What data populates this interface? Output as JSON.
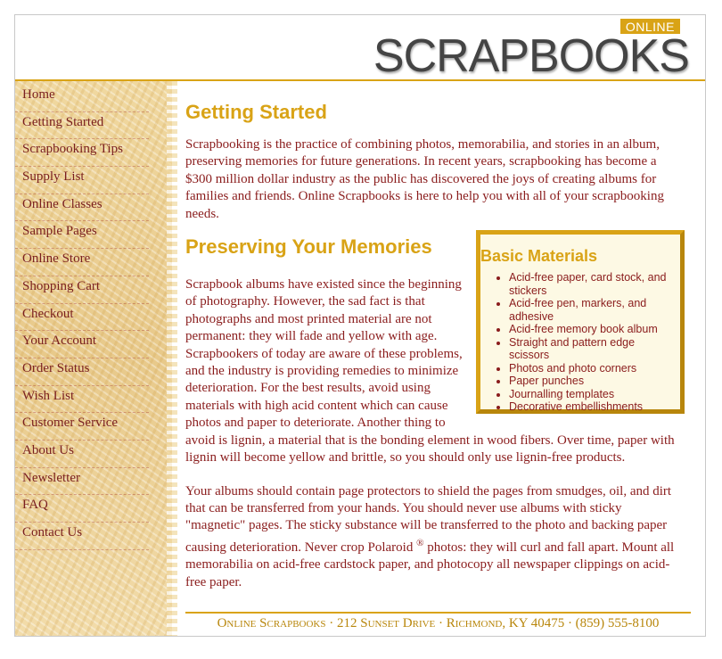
{
  "header": {
    "logo_online": "ONLINE",
    "logo_text": "SCRAPBOOKS"
  },
  "sidebar": {
    "items": [
      {
        "label": "Home"
      },
      {
        "label": "Getting Started"
      },
      {
        "label": "Scrapbooking Tips"
      },
      {
        "label": "Supply List"
      },
      {
        "label": "Online Classes"
      },
      {
        "label": "Sample Pages"
      },
      {
        "label": "Online Store"
      },
      {
        "label": "Shopping Cart"
      },
      {
        "label": "Checkout"
      },
      {
        "label": "Your Account"
      },
      {
        "label": "Order Status"
      },
      {
        "label": "Wish List"
      },
      {
        "label": "Customer Service"
      },
      {
        "label": "About Us"
      },
      {
        "label": "Newsletter"
      },
      {
        "label": "FAQ"
      },
      {
        "label": "Contact Us"
      }
    ]
  },
  "main": {
    "title": "Getting Started",
    "intro": "Scrapbooking is the practice of combining photos, memorabilia, and stories in an album, preserving memories for future generations. In recent years, scrapbooking has become a $300 million dollar industry as the public has discovered the joys of creating albums for families and friends. Online Scrapbooks is here to help you with all of your scrapbooking needs.",
    "section_title": "Preserving Your Memories",
    "para2": "Scrapbook albums have existed since the beginning of photography. However, the sad fact is that photographs and most printed material are not permanent: they will fade and yellow with age. Scrapbookers of today are aware of these problems, and the industry is providing remedies to minimize deterioration. For the best results, avoid using materials with high acid content which can cause photos and paper to deteriorate. Another thing to avoid is lignin, a material that is the bonding element in wood fibers. Over time, paper with lignin will become yellow and brittle, so you should only use lignin-free products.",
    "para3_before": "Your albums should contain page protectors to shield the pages from smudges, oil, and dirt that can be transferred from your hands. You should never use albums with sticky \"magnetic\" pages. The sticky substance will be transferred to the photo and backing paper causing deterioration. Never crop Polaroid ",
    "para3_sup": "®",
    "para3_after": " photos: they will curl and fall apart. Mount all memorabilia on acid-free cardstock paper, and photocopy all newspaper clippings on acid-free paper."
  },
  "box": {
    "title": "Basic Materials",
    "items": [
      "Acid-free paper, card stock, and stickers",
      "Acid-free pen, markers, and adhesive",
      "Acid-free memory book album",
      "Straight and pattern edge scissors",
      "Photos and photo corners",
      "Paper punches",
      "Journalling templates",
      "Decorative embellishments"
    ]
  },
  "footer": {
    "text": "Online Scrapbooks · 212 Sunset Drive · Richmond, KY 40475 · (859) 555-8100"
  }
}
